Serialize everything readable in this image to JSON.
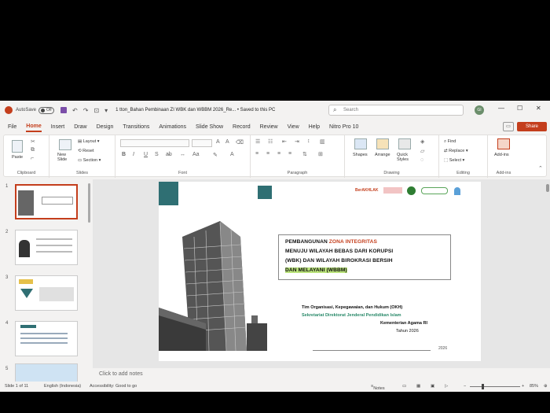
{
  "titlebar": {
    "autosave_label": "AutoSave",
    "autosave_state": "Off",
    "doc_title": "1 tton_Bahan Pembinaan ZI WBK dan WBBM 2026_Re... • Saved to this PC",
    "search_placeholder": "Search",
    "user_initials": "GI"
  },
  "tabs": [
    "File",
    "Home",
    "Insert",
    "Draw",
    "Design",
    "Transitions",
    "Animations",
    "Slide Show",
    "Record",
    "Review",
    "View",
    "Help",
    "Nitro Pro 10"
  ],
  "active_tab": "Home",
  "share_label": "Share",
  "ribbon": {
    "clipboard": {
      "label": "Clipboard",
      "paste": "Paste"
    },
    "slides": {
      "label": "Slides",
      "new_slide": "New Slide",
      "layout": "Layout",
      "reset": "Reset",
      "section": "Section"
    },
    "font": {
      "label": "Font",
      "bold": "B",
      "italic": "I",
      "underline": "U",
      "strike": "S"
    },
    "paragraph": {
      "label": "Paragraph"
    },
    "drawing": {
      "label": "Drawing",
      "shapes": "Shapes",
      "arrange": "Arrange",
      "quick_styles": "Quick Styles"
    },
    "editing": {
      "label": "Editing",
      "find": "Find",
      "replace": "Replace",
      "select": "Select"
    },
    "addins": {
      "label": "Add-ins",
      "addins": "Add-ins"
    }
  },
  "slides_panel": {
    "numbers": [
      "1",
      "2",
      "3",
      "4",
      "5"
    ]
  },
  "slide": {
    "title_line1_a": "PEMBANGUNAN ",
    "title_line1_b": "ZONA INTEGRITAS",
    "title_line2": "MENUJU WILAYAH BEBAS DARI KORUPSI",
    "title_line3": "(WBK) DAN WILAYAH BIROKRASI BERSIH",
    "title_line4": "DAN MELAYANI (WBBM)",
    "team": "Tim Organisasi, Kepegawaian, dan Hukum (OKH)",
    "secretariat": "Sekretariat Direktorat Jenderal Pendidikan Islam",
    "ministry": "Kementerian Agama RI",
    "year": "Tahun 2026",
    "footer_year": "2026",
    "logo_text": "BerAKHLAK"
  },
  "notes_placeholder": "Click to add notes",
  "status": {
    "slide_count": "Slide 1 of 11",
    "language": "English (Indonesia)",
    "accessibility": "Accessibility: Good to go",
    "notes": "Notes",
    "zoom": "85%"
  },
  "colors": {
    "accent": "#c43e1c",
    "teal": "#2f6f73",
    "highlight": "#b9e27a"
  }
}
